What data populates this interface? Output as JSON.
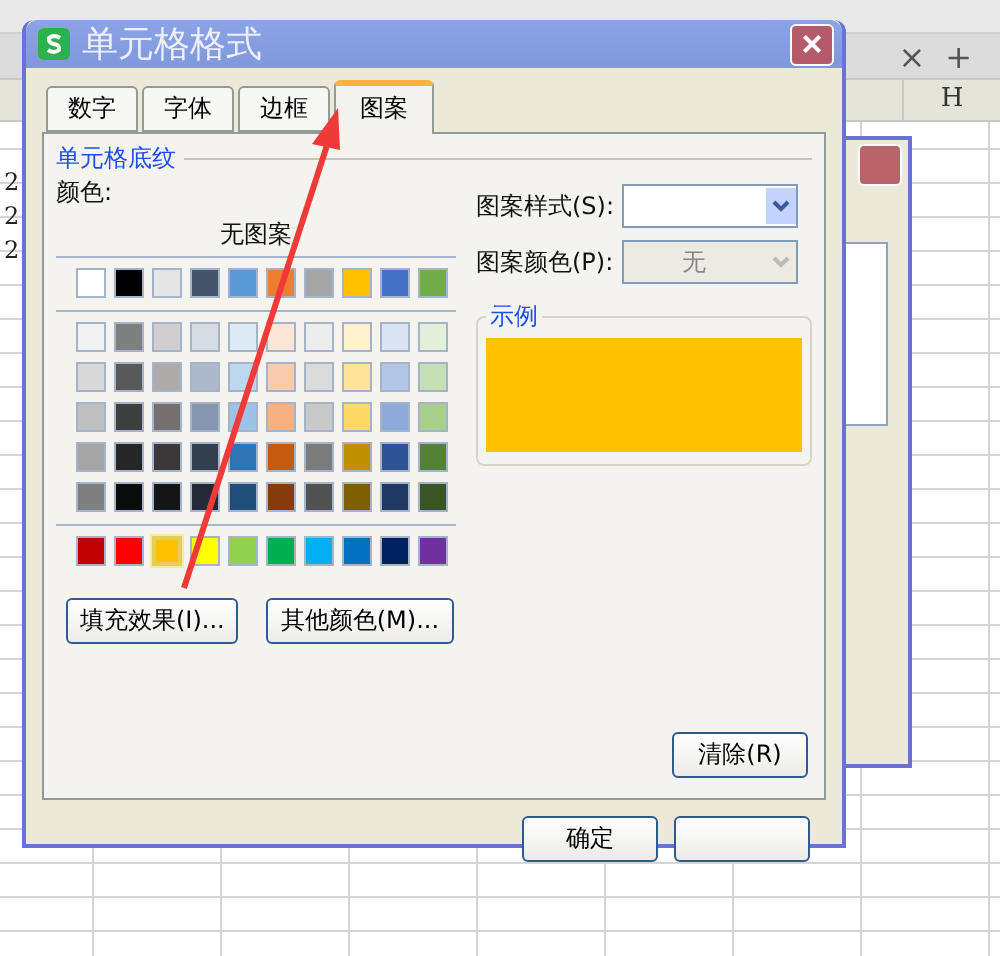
{
  "sheet": {
    "column_header": "H",
    "row_numbers": [
      "2",
      "2",
      "2"
    ],
    "tab_close": "×",
    "tab_add": "+"
  },
  "dialog": {
    "title": "单元格格式",
    "close": "×",
    "tabs": [
      {
        "label": "数字",
        "selected": false
      },
      {
        "label": "字体",
        "selected": false
      },
      {
        "label": "边框",
        "selected": false
      },
      {
        "label": "图案",
        "selected": true
      }
    ],
    "section": "单元格底纹",
    "color_label": "颜色:",
    "palette": {
      "none_label": "无图案",
      "groups": [
        {
          "rows": [
            [
              {
                "color": "#ffffff",
                "selected": false
              },
              {
                "color": "#000000",
                "selected": false
              },
              {
                "color": "#e7e6e6",
                "selected": false
              },
              {
                "color": "#44546a",
                "selected": false
              },
              {
                "color": "#5b9bd5",
                "selected": false
              },
              {
                "color": "#ed7d31",
                "selected": false
              },
              {
                "color": "#a5a5a5",
                "selected": false
              },
              {
                "color": "#ffc000",
                "selected": false
              },
              {
                "color": "#4472c4",
                "selected": false
              },
              {
                "color": "#70ad47",
                "selected": false
              }
            ]
          ]
        },
        {
          "rows": [
            [
              {
                "color": "#f2f2f2",
                "selected": false
              },
              {
                "color": "#7f7f7f",
                "selected": false
              },
              {
                "color": "#d0cece",
                "selected": false
              },
              {
                "color": "#d6dce4",
                "selected": false
              },
              {
                "color": "#deebf6",
                "selected": false
              },
              {
                "color": "#fbe5d5",
                "selected": false
              },
              {
                "color": "#ededed",
                "selected": false
              },
              {
                "color": "#fff2cc",
                "selected": false
              },
              {
                "color": "#dae3f3",
                "selected": false
              },
              {
                "color": "#e2efd9",
                "selected": false
              }
            ],
            [
              {
                "color": "#d8d8d8",
                "selected": false
              },
              {
                "color": "#595959",
                "selected": false
              },
              {
                "color": "#aeabab",
                "selected": false
              },
              {
                "color": "#adb9ca",
                "selected": false
              },
              {
                "color": "#bdd7ee",
                "selected": false
              },
              {
                "color": "#f7cbac",
                "selected": false
              },
              {
                "color": "#dbdbdb",
                "selected": false
              },
              {
                "color": "#fee599",
                "selected": false
              },
              {
                "color": "#b4c6e7",
                "selected": false
              },
              {
                "color": "#c5e0b3",
                "selected": false
              }
            ],
            [
              {
                "color": "#bfbfbf",
                "selected": false
              },
              {
                "color": "#3f3f3f",
                "selected": false
              },
              {
                "color": "#757070",
                "selected": false
              },
              {
                "color": "#8496b0",
                "selected": false
              },
              {
                "color": "#9cc3e5",
                "selected": false
              },
              {
                "color": "#f4b183",
                "selected": false
              },
              {
                "color": "#c9c9c9",
                "selected": false
              },
              {
                "color": "#ffd965",
                "selected": false
              },
              {
                "color": "#8eaadb",
                "selected": false
              },
              {
                "color": "#a8d08d",
                "selected": false
              }
            ],
            [
              {
                "color": "#a5a5a5",
                "selected": false
              },
              {
                "color": "#262626",
                "selected": false
              },
              {
                "color": "#3a3838",
                "selected": false
              },
              {
                "color": "#323f4f",
                "selected": false
              },
              {
                "color": "#2e75b5",
                "selected": false
              },
              {
                "color": "#c55a11",
                "selected": false
              },
              {
                "color": "#7b7b7b",
                "selected": false
              },
              {
                "color": "#bf9000",
                "selected": false
              },
              {
                "color": "#2f5496",
                "selected": false
              },
              {
                "color": "#538135",
                "selected": false
              }
            ],
            [
              {
                "color": "#7f7f7f",
                "selected": false
              },
              {
                "color": "#0c0c0c",
                "selected": false
              },
              {
                "color": "#171616",
                "selected": false
              },
              {
                "color": "#222a35",
                "selected": false
              },
              {
                "color": "#1e4e79",
                "selected": false
              },
              {
                "color": "#843c0b",
                "selected": false
              },
              {
                "color": "#525252",
                "selected": false
              },
              {
                "color": "#7f6000",
                "selected": false
              },
              {
                "color": "#1f3864",
                "selected": false
              },
              {
                "color": "#375623",
                "selected": false
              }
            ]
          ]
        },
        {
          "rows": [
            [
              {
                "color": "#c00000",
                "selected": false
              },
              {
                "color": "#ff0000",
                "selected": false
              },
              {
                "color": "#ffc000",
                "selected": true
              },
              {
                "color": "#ffff00",
                "selected": false
              },
              {
                "color": "#92d050",
                "selected": false
              },
              {
                "color": "#00b050",
                "selected": false
              },
              {
                "color": "#00b0f0",
                "selected": false
              },
              {
                "color": "#0070c0",
                "selected": false
              },
              {
                "color": "#002060",
                "selected": false
              },
              {
                "color": "#7030a0",
                "selected": false
              }
            ]
          ]
        }
      ]
    },
    "fill_buttons": [
      "填充效果(I)...",
      "其他颜色(M)..."
    ],
    "pattern_style": {
      "label": "图案样式(S):",
      "disabled": false
    },
    "pattern_color": {
      "label": "图案颜色(P):",
      "value": "无",
      "disabled": true
    },
    "sample": {
      "label": "示例",
      "color": "#ffc000"
    },
    "clear_button": "清除(R)",
    "ok_button": "确定"
  }
}
